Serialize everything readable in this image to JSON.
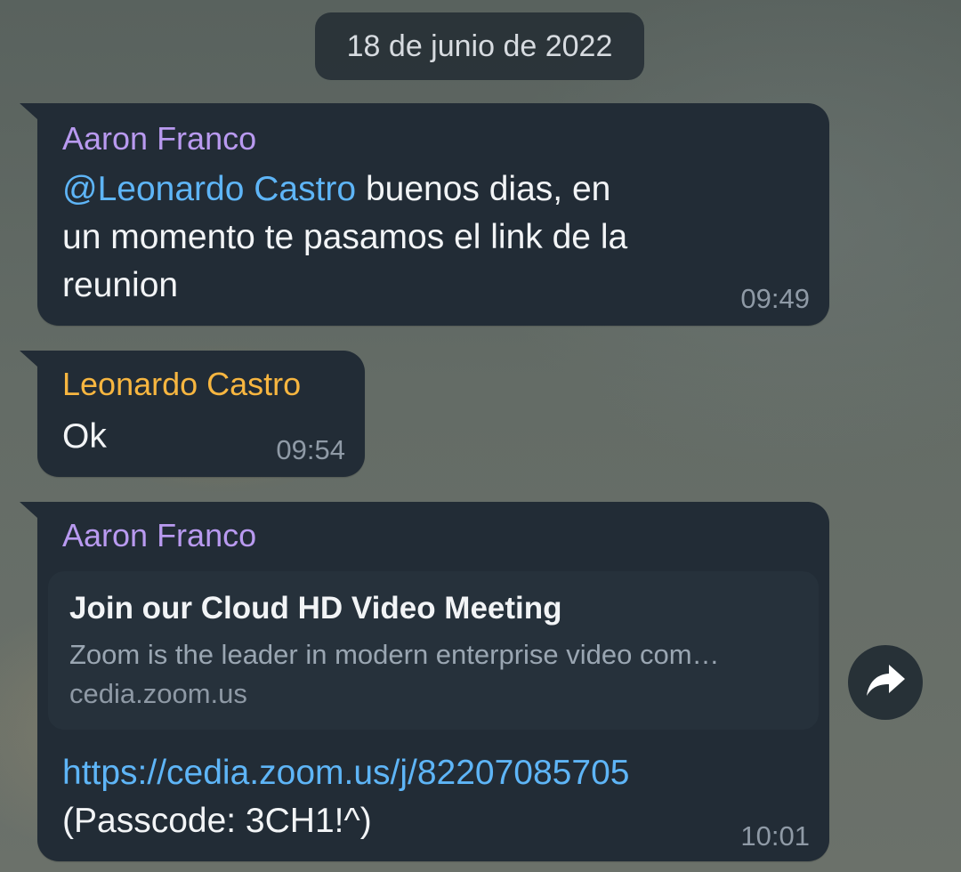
{
  "date_separator": "18 de junio de 2022",
  "messages": [
    {
      "sender": "Aaron Franco",
      "mention": "@Leonardo Castro",
      "text": " buenos dias, en\nun momento te pasamos el link de la\nreunion",
      "time": "09:49"
    },
    {
      "sender": "Leonardo Castro",
      "text": "Ok",
      "time": "09:54"
    },
    {
      "sender": "Aaron Franco",
      "preview": {
        "title": "Join our Cloud HD Video Meeting",
        "description": "Zoom is the leader in modern enterprise video com…",
        "domain": "cedia.zoom.us"
      },
      "link": "https://cedia.zoom.us/j/82207085705",
      "text": "(Passcode: 3CH1!^)",
      "time": "10:01"
    }
  ],
  "share_button_icon": "share-arrow-icon",
  "colors": {
    "bubble": "#222c36",
    "sender_purple": "#b99af0",
    "sender_orange": "#f7b640",
    "link": "#5eb5f7",
    "time": "#8f9aa6"
  }
}
